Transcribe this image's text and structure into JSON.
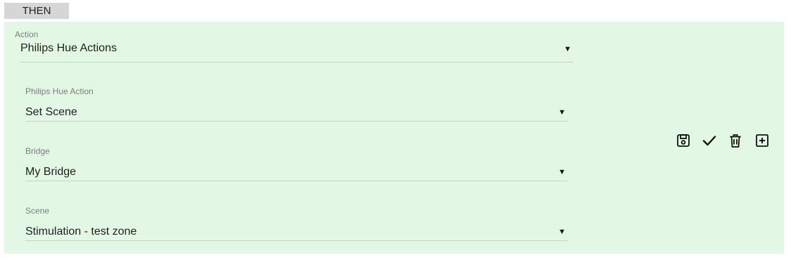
{
  "section_tag": "THEN",
  "action": {
    "label": "Action",
    "value": "Philips Hue Actions",
    "caret": "▼"
  },
  "fields": [
    {
      "label": "Philips Hue Action",
      "value": "Set Scene",
      "caret": "▼"
    },
    {
      "label": "Bridge",
      "value": "My Bridge",
      "caret": "▼"
    },
    {
      "label": "Scene",
      "value": "Stimulation - test zone",
      "caret": "▼"
    }
  ],
  "toolbar": {
    "icons": [
      "save-icon",
      "check-icon",
      "trash-icon",
      "add-box-icon"
    ]
  },
  "colors": {
    "panel_background": "#e2f8e4",
    "tag_background": "#d6d6d6"
  }
}
